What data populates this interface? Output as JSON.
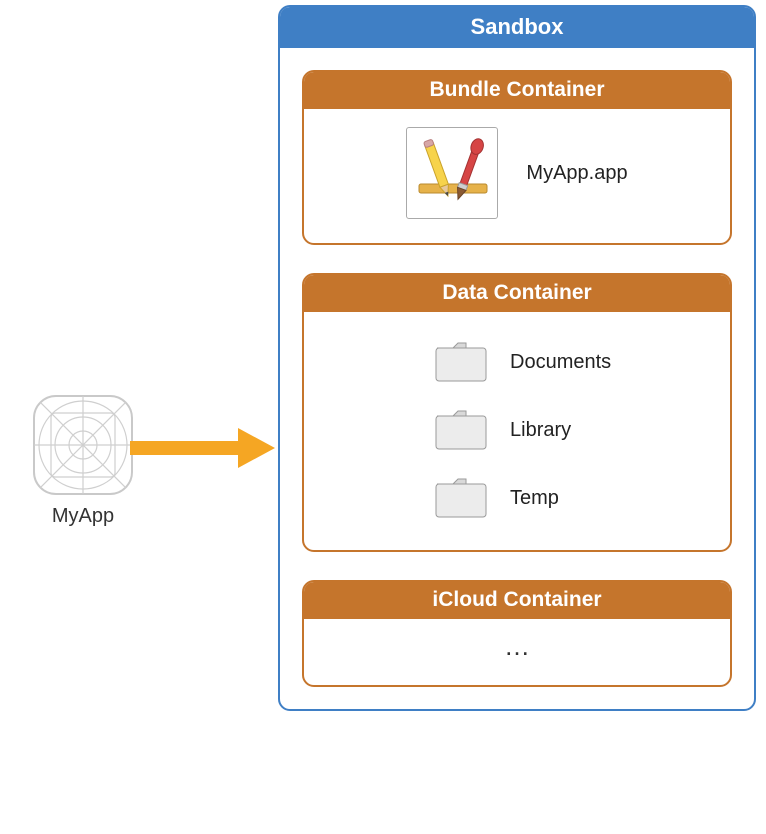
{
  "app": {
    "name": "MyApp"
  },
  "sandbox": {
    "title": "Sandbox",
    "bundle": {
      "title": "Bundle Container",
      "app_file": "MyApp.app"
    },
    "data": {
      "title": "Data Container",
      "folders": [
        {
          "label": "Documents"
        },
        {
          "label": "Library"
        },
        {
          "label": "Temp"
        }
      ]
    },
    "icloud": {
      "title": "iCloud Container",
      "content": "…"
    }
  }
}
